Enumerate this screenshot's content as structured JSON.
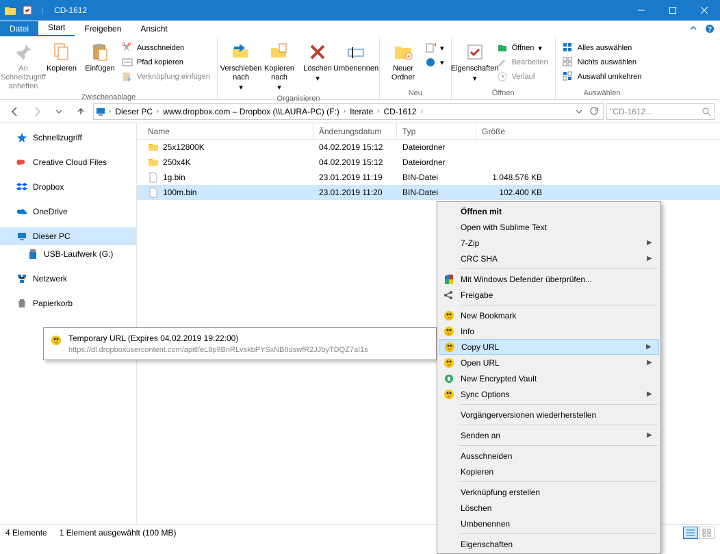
{
  "title": "CD-1612",
  "tabs": {
    "file": "Datei",
    "start": "Start",
    "share": "Freigeben",
    "view": "Ansicht"
  },
  "ribbon": {
    "clipboard": {
      "pin": "An Schnellzugriff anheften",
      "copy": "Kopieren",
      "paste": "Einfügen",
      "cut": "Ausschneiden",
      "copy_path": "Pfad kopieren",
      "paste_shortcut": "Verknüpfung einfügen",
      "label": "Zwischenablage"
    },
    "organize": {
      "move_to": "Verschieben nach",
      "copy_to": "Kopieren nach",
      "delete": "Löschen",
      "rename": "Umbenennen",
      "label": "Organisieren"
    },
    "new": {
      "new_folder": "Neuer Ordner",
      "label": "Neu"
    },
    "open": {
      "properties": "Eigenschaften",
      "open": "Öffnen",
      "edit": "Bearbeiten",
      "history": "Verlauf",
      "label": "Öffnen"
    },
    "select": {
      "select_all": "Alles auswählen",
      "select_none": "Nichts auswählen",
      "invert": "Auswahl umkehren",
      "label": "Auswählen"
    }
  },
  "breadcrumb": [
    "Dieser PC",
    "www.dropbox.com – Dropbox (\\\\LAURA-PC) (F:)",
    "Iterate",
    "CD-1612"
  ],
  "search_placeholder": "\"CD-1612...",
  "sidebar": {
    "quick": "Schnellzugriff",
    "ccf": "Creative Cloud Files",
    "dropbox": "Dropbox",
    "onedrive": "OneDrive",
    "this_pc": "Dieser PC",
    "usb": "USB-Laufwerk (G:)",
    "network": "Netzwerk",
    "recycle": "Papierkorb"
  },
  "columns": {
    "name": "Name",
    "date": "Änderungsdatum",
    "type": "Typ",
    "size": "Größe"
  },
  "files": [
    {
      "name": "25x12800K",
      "date": "04.02.2019 15:12",
      "type": "Dateiordner",
      "size": "",
      "icon": "folder"
    },
    {
      "name": "250x4K",
      "date": "04.02.2019 15:12",
      "type": "Dateiordner",
      "size": "",
      "icon": "folder"
    },
    {
      "name": "1g.bin",
      "date": "23.01.2019 11:19",
      "type": "BIN-Datei",
      "size": "1.048.576 KB",
      "icon": "file"
    },
    {
      "name": "100m.bin",
      "date": "23.01.2019 11:20",
      "type": "BIN-Datei",
      "size": "102.400 KB",
      "icon": "file",
      "selected": true
    }
  ],
  "context_menu": [
    {
      "label": "Öffnen mit",
      "bold": true
    },
    {
      "label": "Open with Sublime Text"
    },
    {
      "label": "7-Zip",
      "sub": true
    },
    {
      "label": "CRC SHA",
      "sub": true
    },
    {
      "sep": true
    },
    {
      "label": "Mit Windows Defender überprüfen...",
      "icon": "shield"
    },
    {
      "label": "Freigabe",
      "icon": "share"
    },
    {
      "sep": true
    },
    {
      "label": "New Bookmark",
      "icon": "cd"
    },
    {
      "label": "Info",
      "icon": "cd"
    },
    {
      "label": "Copy URL",
      "icon": "cd",
      "sub": true,
      "hover": true
    },
    {
      "label": "Open URL",
      "icon": "cd",
      "sub": true
    },
    {
      "label": "New Encrypted Vault",
      "icon": "vault"
    },
    {
      "label": "Sync Options",
      "icon": "cd",
      "sub": true
    },
    {
      "sep": true
    },
    {
      "label": "Vorgängerversionen wiederherstellen"
    },
    {
      "sep": true
    },
    {
      "label": "Senden an",
      "sub": true
    },
    {
      "sep": true
    },
    {
      "label": "Ausschneiden"
    },
    {
      "label": "Kopieren"
    },
    {
      "sep": true
    },
    {
      "label": "Verknüpfung erstellen"
    },
    {
      "label": "Löschen"
    },
    {
      "label": "Umbenennen"
    },
    {
      "sep": true
    },
    {
      "label": "Eigenschaften"
    }
  ],
  "tooltip": {
    "title": "Temporary URL (Expires 04.02.2019 19:22:00)",
    "url": "https://dl.dropboxusercontent.com/apitl/eL8p9BnRLvskbPYSxNB6dswfR2JJbyTDQZ7aI1s"
  },
  "status": {
    "count": "4 Elemente",
    "selected": "1 Element ausgewählt (100 MB)"
  }
}
